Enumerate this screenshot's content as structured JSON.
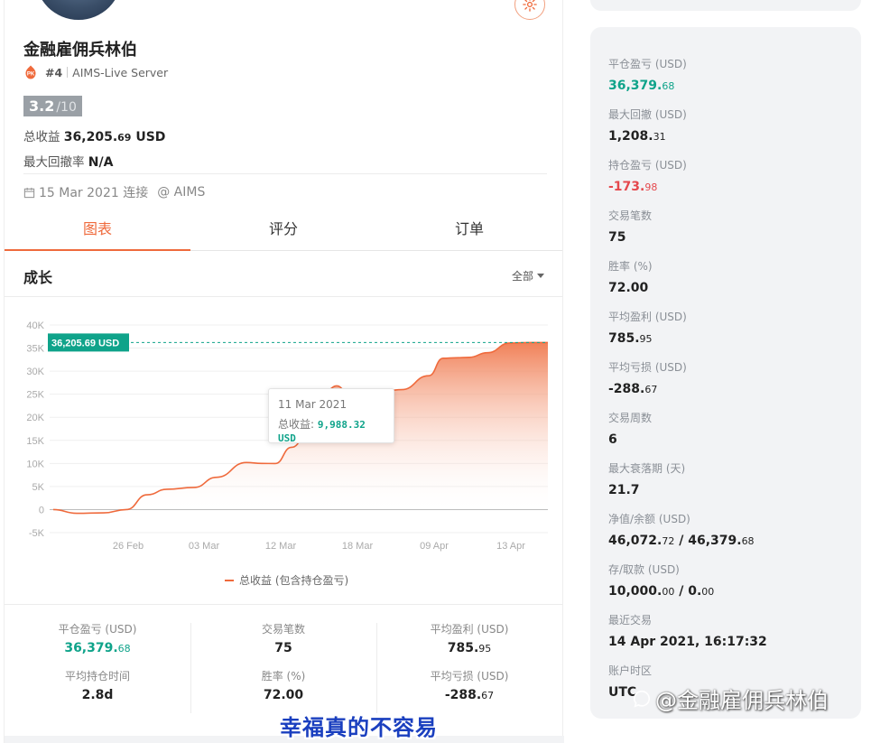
{
  "profile": {
    "name": "金融雇佣兵林伯",
    "rank": "#4",
    "server": "AIMS-Live Server",
    "score": "3.2",
    "score_max": "/10",
    "total_profit_label": "总收益",
    "total_profit_main": "36,205.",
    "total_profit_small": "69",
    "total_profit_unit": "USD",
    "max_drawdown_rate_label": "最大回撤率",
    "max_drawdown_rate_value": "N/A",
    "connected_date": "15 Mar 2021 连接",
    "connected_via": "@ AIMS"
  },
  "tabs": [
    "图表",
    "评分",
    "订单"
  ],
  "growth": {
    "title": "成长",
    "filter": "全部"
  },
  "tooltip": {
    "date": "11 Mar 2021",
    "label": "总收益:",
    "value": "9,988.32 USD"
  },
  "chart_data": {
    "type": "area",
    "title": "",
    "ylim": [
      -5000,
      40000
    ],
    "y_ticks": [
      "40K",
      "35K",
      "30K",
      "25K",
      "20K",
      "15K",
      "10K",
      "5K",
      "0",
      "-5K"
    ],
    "x_ticks": [
      "26 Feb",
      "03 Mar",
      "12 Mar",
      "18 Mar",
      "09 Apr",
      "13 Apr"
    ],
    "current_label": "36,205.69 USD",
    "current_value": 36205.69,
    "series": [
      {
        "name": "总收益 (包含持仓盈亏)",
        "x": [
          "20 Feb",
          "23 Feb",
          "26 Feb",
          "28 Feb",
          "01 Mar",
          "03 Mar",
          "05 Mar",
          "07 Mar",
          "09 Mar",
          "10 Mar",
          "11 Mar",
          "12 Mar",
          "14 Mar",
          "15 Mar",
          "16 Mar",
          "17 Mar",
          "18 Mar",
          "20 Mar",
          "25 Mar",
          "01 Apr",
          "05 Apr",
          "07 Apr",
          "09 Apr",
          "11 Apr",
          "12 Apr",
          "13 Apr",
          "14 Apr"
        ],
        "values": [
          0,
          -800,
          -700,
          0,
          3200,
          4400,
          4800,
          7000,
          10200,
          10000,
          9988,
          13500,
          18000,
          26000,
          26800,
          25500,
          25000,
          25200,
          26000,
          29000,
          32800,
          32900,
          33000,
          34000,
          36100,
          36200,
          36205
        ]
      }
    ],
    "legend": [
      "总收益 (包含持仓盈亏)"
    ],
    "legend_position": "bottom"
  },
  "summary": [
    {
      "label": "平仓盈亏 (USD)",
      "main": "36,379.",
      "small": "68",
      "color": "green"
    },
    {
      "label": "交易笔数",
      "main": "75",
      "small": "",
      "color": ""
    },
    {
      "label": "平均盈利 (USD)",
      "main": "785.",
      "small": "95",
      "color": ""
    },
    {
      "label": "平均持仓时间",
      "main": "2.8d",
      "small": "",
      "color": ""
    },
    {
      "label": "胜率 (%)",
      "main": "72.00",
      "small": "",
      "color": ""
    },
    {
      "label": "平均亏损 (USD)",
      "main": "-288.",
      "small": "67",
      "color": ""
    }
  ],
  "right_stats": [
    {
      "label": "平仓盈亏 (USD)",
      "main": "36,379.",
      "small": "68",
      "color": "green"
    },
    {
      "label": "最大回撤 (USD)",
      "main": "1,208.",
      "small": "31",
      "color": ""
    },
    {
      "label": "持仓盈亏 (USD)",
      "main": "-173.",
      "small": "98",
      "color": "red"
    },
    {
      "label": "交易笔数",
      "main": "75",
      "small": "",
      "color": ""
    },
    {
      "label": "胜率 (%)",
      "main": "72.00",
      "small": "",
      "color": ""
    },
    {
      "label": "平均盈利 (USD)",
      "main": "785.",
      "small": "95",
      "color": ""
    },
    {
      "label": "平均亏损 (USD)",
      "main": "-288.",
      "small": "67",
      "color": ""
    },
    {
      "label": "交易周数",
      "main": "6",
      "small": "",
      "color": ""
    },
    {
      "label": "最大衰落期 (天)",
      "main": "21.7",
      "small": "",
      "color": ""
    },
    {
      "label": "净值/余额 (USD)",
      "main": "46,072.",
      "small": "72",
      "main2": " / 46,379.",
      "small2": "68",
      "color": ""
    },
    {
      "label": "存/取款 (USD)",
      "main": "10,000.",
      "small": "00",
      "main2": " / 0.",
      "small2": "00",
      "color": ""
    },
    {
      "label": "最近交易",
      "main": "14 Apr 2021, 16:17:32",
      "small": "",
      "color": ""
    },
    {
      "label": "账户时区",
      "main": "UTC",
      "small": "",
      "color": ""
    }
  ],
  "overlay": {
    "subtitle": "幸福真的不容易",
    "watermark": "@金融雇佣兵林伯"
  },
  "colors": {
    "accent": "#ef6a3c",
    "green": "#0fa38a",
    "red": "#e5484d"
  }
}
